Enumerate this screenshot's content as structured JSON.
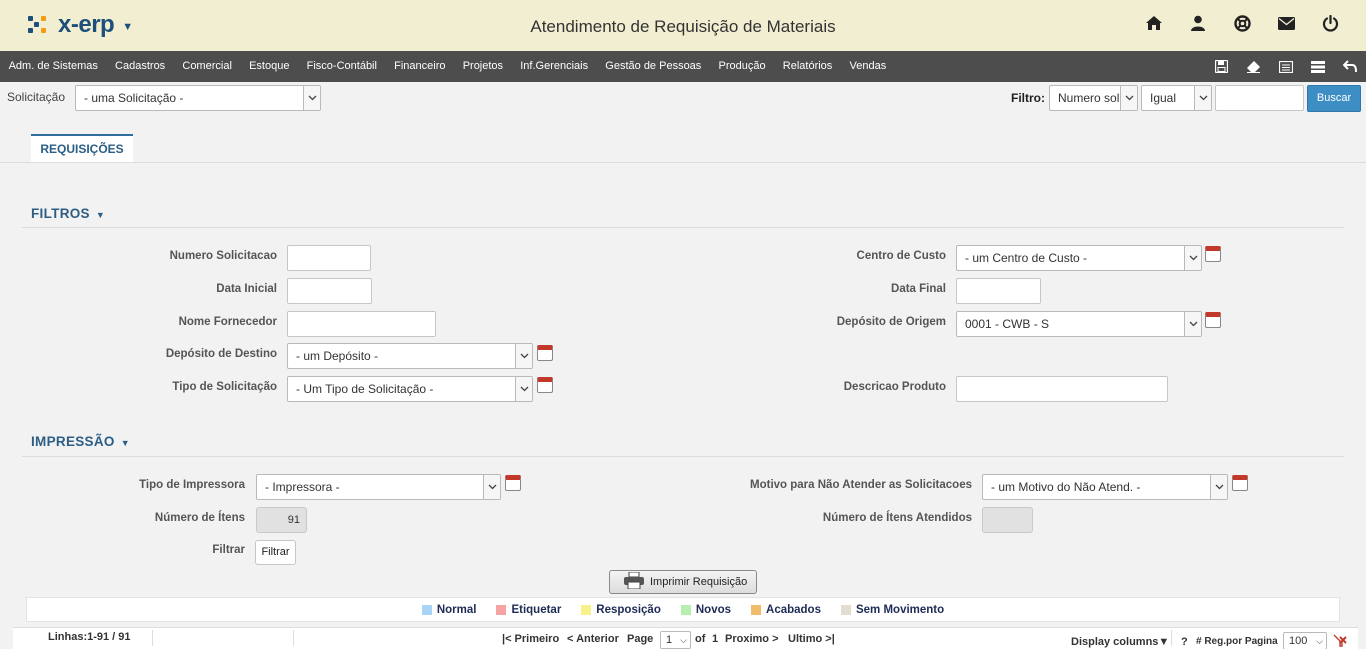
{
  "app": {
    "logo_text": "x-erp",
    "title": "Atendimento de Requisição de Materiais"
  },
  "header_icons": [
    "home-icon",
    "user-icon",
    "lifebuoy-icon",
    "mail-icon",
    "power-icon"
  ],
  "menu": {
    "items": [
      "Adm. de Sistemas",
      "Cadastros",
      "Comercial",
      "Estoque",
      "Fisco-Contábil",
      "Financeiro",
      "Projetos",
      "Inf.Gerenciais",
      "Gestão de Pessoas",
      "Produção",
      "Relatórios",
      "Vendas"
    ],
    "tools": [
      "save-icon",
      "eraser-icon",
      "form-icon",
      "list-icon",
      "back-icon"
    ]
  },
  "topbar": {
    "solicitacao_label": "Solicitação",
    "solicitacao_value": "- uma Solicitação -",
    "filtro_label": "Filtro:",
    "filtro_field": "Numero sol",
    "filtro_op": "Igual",
    "filtro_value": "",
    "buscar_label": "Buscar"
  },
  "tabs": [
    {
      "label": "REQUISIÇÕES"
    }
  ],
  "filtros": {
    "title": "FILTROS",
    "numero_solicitacao_label": "Numero Solicitacao",
    "data_inicial_label": "Data Inicial",
    "nome_fornecedor_label": "Nome Fornecedor",
    "deposito_destino_label": "Depósito de Destino",
    "deposito_destino_value": "- um Depósito -",
    "tipo_solicitacao_label": "Tipo de Solicitação",
    "tipo_solicitacao_value": "- Um Tipo de Solicitação -",
    "centro_custo_label": "Centro de Custo",
    "centro_custo_value": "- um Centro de Custo -",
    "data_final_label": "Data Final",
    "deposito_origem_label": "Depósito de Origem",
    "deposito_origem_value": "0001 - CWB - S",
    "descricao_produto_label": "Descricao Produto"
  },
  "impressao": {
    "title": "IMPRESSÃO",
    "tipo_impressora_label": "Tipo de Impressora",
    "tipo_impressora_value": "- Impressora -",
    "numero_itens_label": "Número de Ítens",
    "numero_itens_value": "91",
    "filtrar_label": "Filtrar",
    "filtrar_button": "Filtrar",
    "motivo_label": "Motivo para Não Atender as Solicitacoes",
    "motivo_value": "- um Motivo do Não Atend. -",
    "numero_itens_atendidos_label": "Número de Ítens Atendidos",
    "numero_itens_atendidos_value": "",
    "print_button": "Imprimir Requisição"
  },
  "legend": [
    {
      "label": "Normal",
      "color": "#a9d4f5"
    },
    {
      "label": "Etiquetar",
      "color": "#f5a3a3"
    },
    {
      "label": "Resposição",
      "color": "#f7f28a"
    },
    {
      "label": "Novos",
      "color": "#b6f0b0"
    },
    {
      "label": "Acabados",
      "color": "#f2bd6b"
    },
    {
      "label": "Sem Movimento",
      "color": "#e2ddd0"
    }
  ],
  "footer": {
    "linhas": "Linhas:1-91 / 91",
    "primeiro": "|< Primeiro",
    "anterior": "< Anterior",
    "page_label": "Page",
    "page_value": "1",
    "of_label": "of",
    "total_pages": "1",
    "proximo": "Proximo >",
    "ultimo": "Ultimo >|",
    "display_columns": "Display columns▼",
    "help": "?",
    "reg_label": "# Reg.por Pagina",
    "reg_value": "100"
  }
}
